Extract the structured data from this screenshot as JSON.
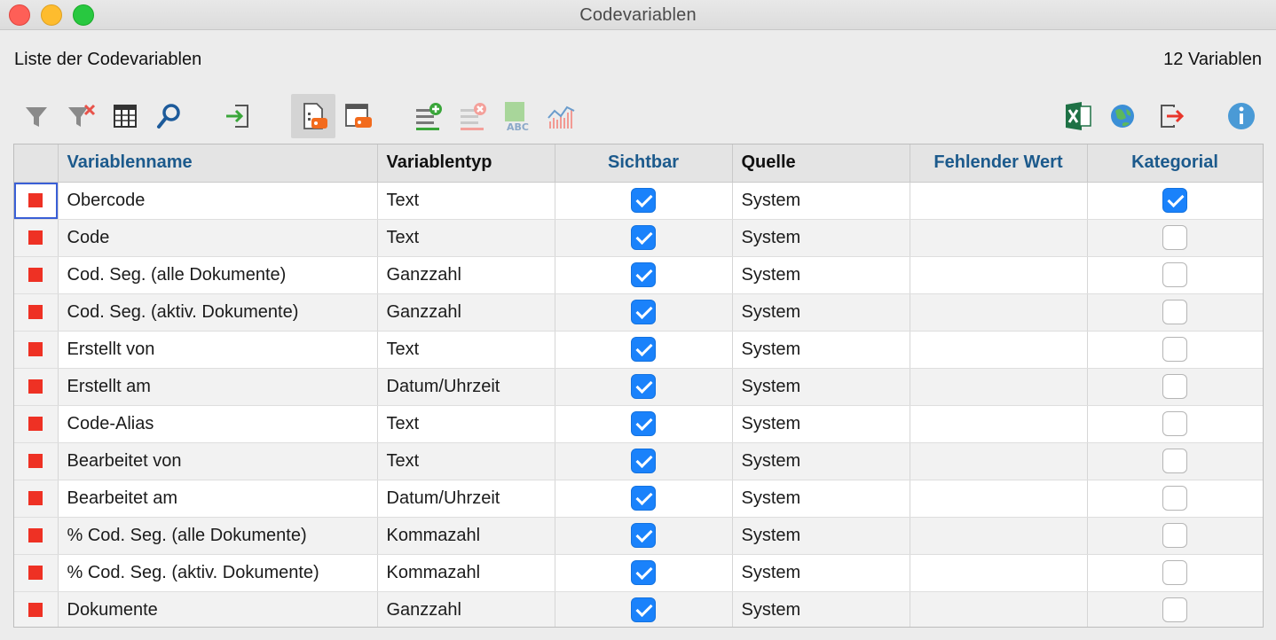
{
  "window": {
    "title": "Codevariablen"
  },
  "header": {
    "list_label": "Liste der Codevariablen",
    "count_label": "12 Variablen"
  },
  "toolbar": {
    "left_icons": [
      "filter-icon",
      "clear-filter-icon",
      "columns-icon",
      "search-icon",
      "import-icon",
      "code-variable-icon",
      "document-variable-icon",
      "add-variable-icon",
      "delete-variable-icon",
      "abc-icon",
      "chart-icon"
    ],
    "right_icons": [
      "excel-icon",
      "web-icon",
      "export-icon",
      "info-icon"
    ]
  },
  "colors": {
    "accent": "#1a82fb",
    "marker": "#ee3124",
    "header_blue": "#1c5a8c"
  },
  "table": {
    "columns": [
      "",
      "Variablenname",
      "Variablentyp",
      "Sichtbar",
      "Quelle",
      "Fehlender Wert",
      "Kategorial"
    ],
    "rows": [
      {
        "name": "Obercode",
        "type": "Text",
        "visible": true,
        "source": "System",
        "missing": "",
        "categorical": true
      },
      {
        "name": "Code",
        "type": "Text",
        "visible": true,
        "source": "System",
        "missing": "",
        "categorical": false
      },
      {
        "name": "Cod. Seg. (alle Dokumente)",
        "type": "Ganzzahl",
        "visible": true,
        "source": "System",
        "missing": "",
        "categorical": false
      },
      {
        "name": "Cod. Seg. (aktiv. Dokumente)",
        "type": "Ganzzahl",
        "visible": true,
        "source": "System",
        "missing": "",
        "categorical": false
      },
      {
        "name": "Erstellt von",
        "type": "Text",
        "visible": true,
        "source": "System",
        "missing": "",
        "categorical": false
      },
      {
        "name": "Erstellt am",
        "type": "Datum/Uhrzeit",
        "visible": true,
        "source": "System",
        "missing": "",
        "categorical": false
      },
      {
        "name": "Code-Alias",
        "type": "Text",
        "visible": true,
        "source": "System",
        "missing": "",
        "categorical": false
      },
      {
        "name": "Bearbeitet von",
        "type": "Text",
        "visible": true,
        "source": "System",
        "missing": "",
        "categorical": false
      },
      {
        "name": "Bearbeitet am",
        "type": "Datum/Uhrzeit",
        "visible": true,
        "source": "System",
        "missing": "",
        "categorical": false
      },
      {
        "name": "% Cod. Seg. (alle Dokumente)",
        "type": "Kommazahl",
        "visible": true,
        "source": "System",
        "missing": "",
        "categorical": false
      },
      {
        "name": "% Cod. Seg. (aktiv. Dokumente)",
        "type": "Kommazahl",
        "visible": true,
        "source": "System",
        "missing": "",
        "categorical": false
      },
      {
        "name": "Dokumente",
        "type": "Ganzzahl",
        "visible": true,
        "source": "System",
        "missing": "",
        "categorical": false
      }
    ]
  }
}
